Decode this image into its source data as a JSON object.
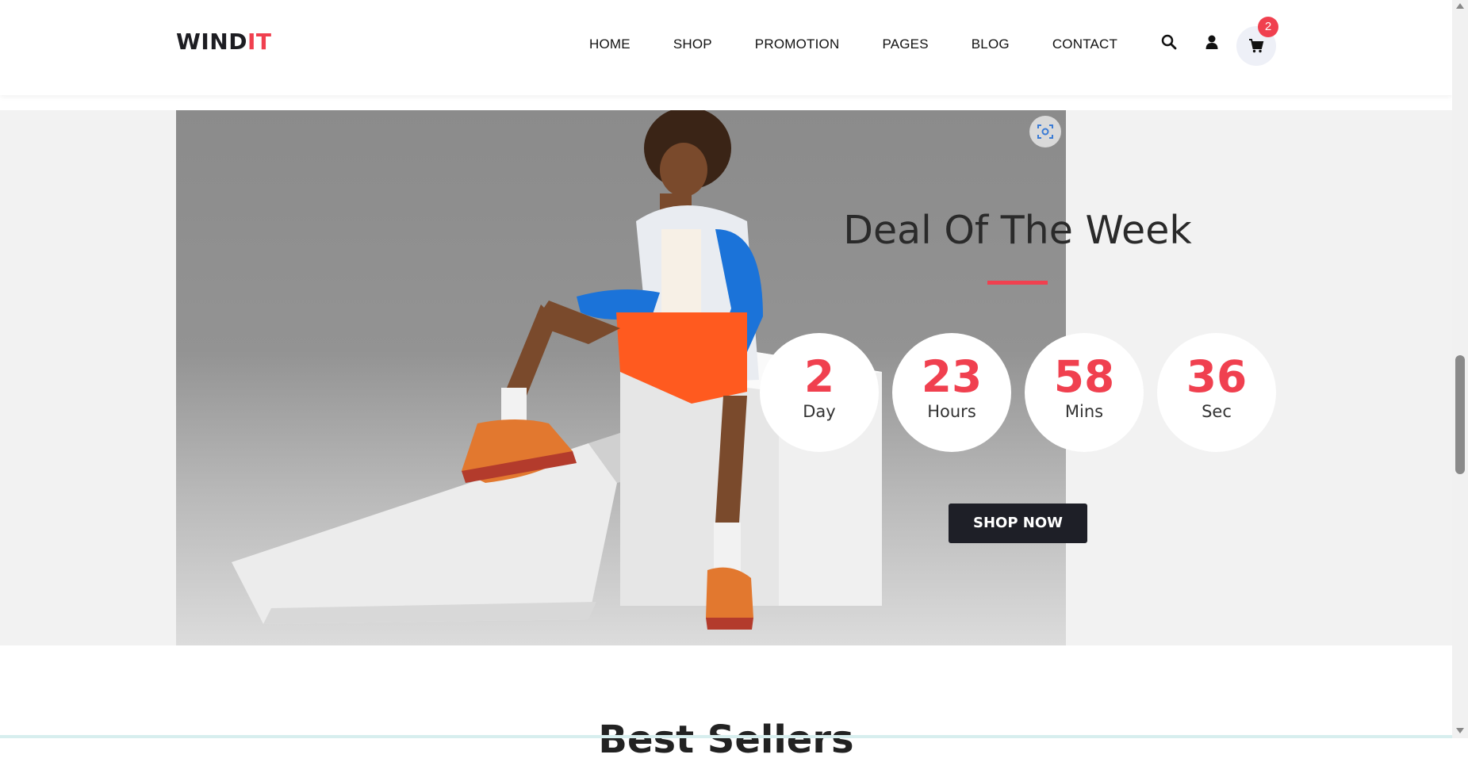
{
  "header": {
    "logo_main": "WIND",
    "logo_accent": "IT",
    "nav": [
      "HOME",
      "SHOP",
      "PROMOTION",
      "PAGES",
      "BLOG",
      "CONTACT"
    ],
    "cart_count": "2"
  },
  "deal": {
    "title": "Deal Of The Week",
    "timer": [
      {
        "value": "2",
        "unit": "Day"
      },
      {
        "value": "23",
        "unit": "Hours"
      },
      {
        "value": "58",
        "unit": "Mins"
      },
      {
        "value": "36",
        "unit": "Sec"
      }
    ],
    "button_label": "SHOP NOW"
  },
  "next_section": {
    "title": "Best Sellers"
  },
  "colors": {
    "accent": "#f0404f",
    "dark": "#1e1f27"
  },
  "icons": [
    "search-icon",
    "user-icon",
    "cart-icon",
    "scan-icon"
  ]
}
